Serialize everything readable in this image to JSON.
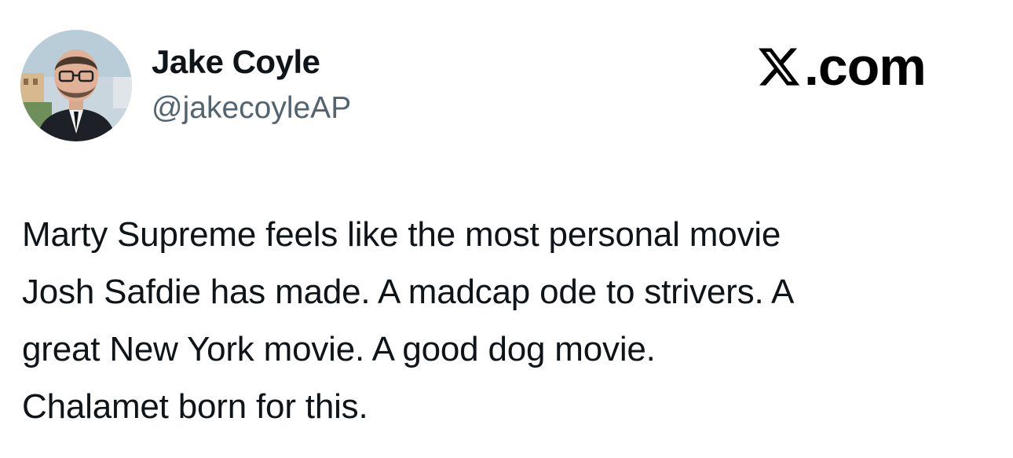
{
  "author": {
    "display_name": "Jake Coyle",
    "handle": "@jakecoyleAP",
    "avatar": "profile-photo"
  },
  "brand": {
    "logo_icon": "x-logo-icon",
    "suffix": ".com"
  },
  "tweet": {
    "lines": [
      "Marty Supreme feels like the most personal movie",
      "Josh Safdie has made. A madcap ode to strivers. A",
      "great New York movie. A good dog movie.",
      "Chalamet born for this."
    ]
  }
}
